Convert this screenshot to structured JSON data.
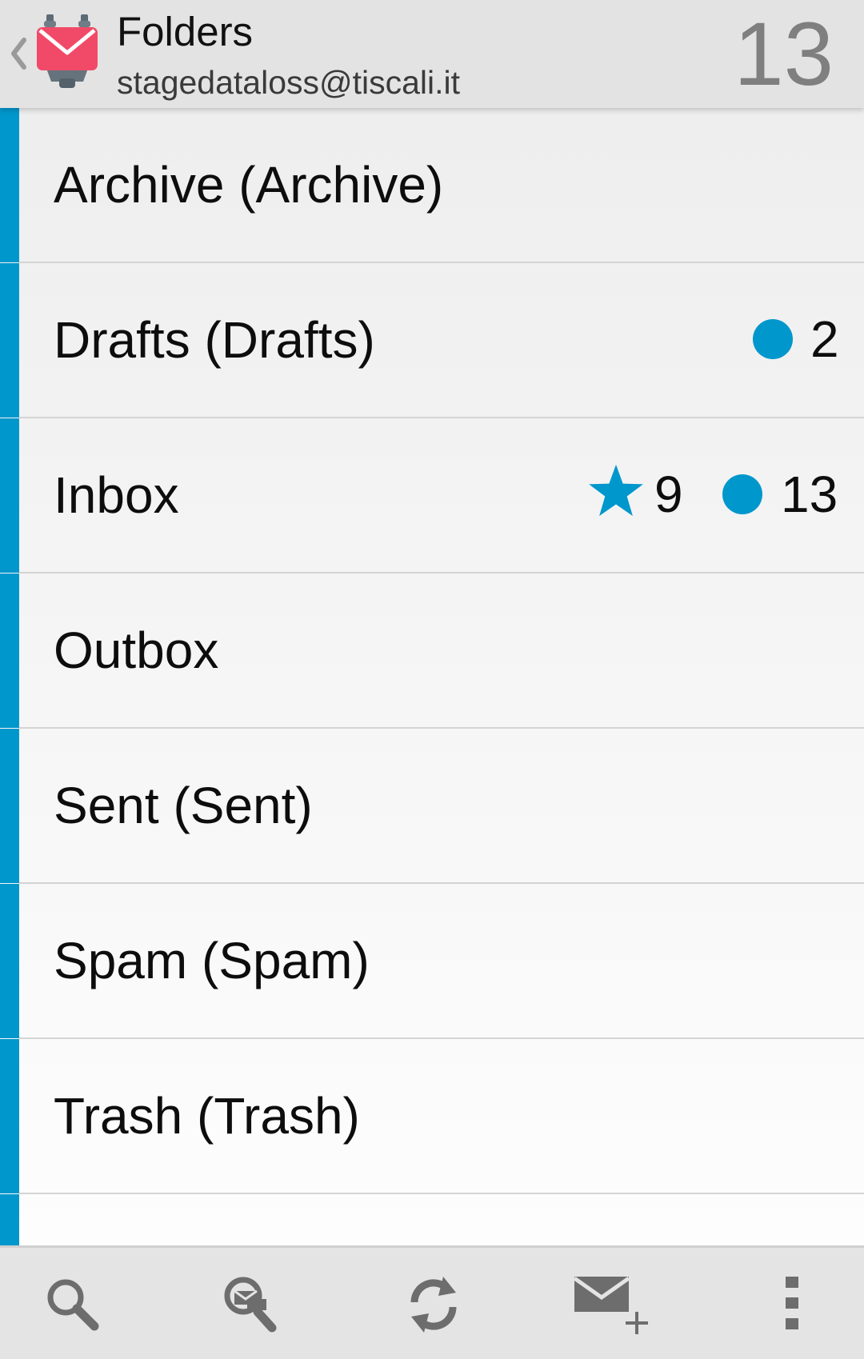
{
  "header": {
    "title": "Folders",
    "account": "stagedataloss@tiscali.it",
    "unread_total": "13",
    "accent_color": "#0097cc"
  },
  "folders": [
    {
      "name": "Archive (Archive)",
      "starred": null,
      "unread": null
    },
    {
      "name": "Drafts (Drafts)",
      "starred": null,
      "unread": "2"
    },
    {
      "name": "Inbox",
      "starred": "9",
      "unread": "13"
    },
    {
      "name": "Outbox",
      "starred": null,
      "unread": null
    },
    {
      "name": "Sent (Sent)",
      "starred": null,
      "unread": null
    },
    {
      "name": "Spam (Spam)",
      "starred": null,
      "unread": null
    },
    {
      "name": "Trash (Trash)",
      "starred": null,
      "unread": null
    },
    {
      "name": "",
      "starred": null,
      "unread": null
    }
  ],
  "toolbar": {
    "buttons": [
      {
        "icon": "search-icon"
      },
      {
        "icon": "search-everywhere-icon"
      },
      {
        "icon": "refresh-icon"
      },
      {
        "icon": "compose-icon"
      },
      {
        "icon": "overflow-menu-icon"
      }
    ]
  }
}
